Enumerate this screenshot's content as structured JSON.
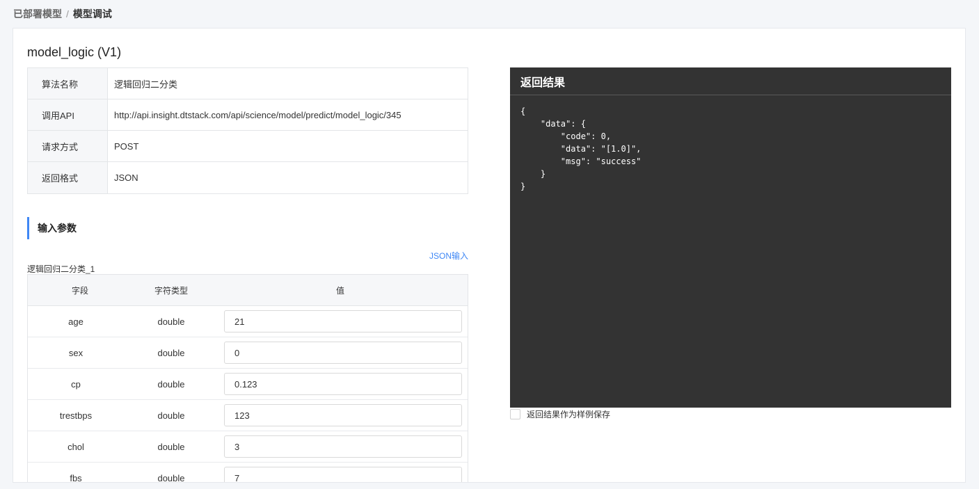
{
  "breadcrumb": {
    "parent": "已部署模型",
    "separator": "/",
    "current": "模型调试"
  },
  "model_title": "model_logic (V1)",
  "info": [
    {
      "key": "算法名称",
      "value": "逻辑回归二分类"
    },
    {
      "key": "调用API",
      "value": "http://api.insight.dtstack.com/api/science/model/predict/model_logic/345"
    },
    {
      "key": "请求方式",
      "value": "POST"
    },
    {
      "key": "返回格式",
      "value": "JSON"
    }
  ],
  "input_section": {
    "title": "输入参数",
    "json_link": "JSON输入",
    "group_label": "逻辑回归二分类_1",
    "headers": {
      "field": "字段",
      "type": "字符类型",
      "value": "值"
    },
    "rows": [
      {
        "field": "age",
        "type": "double",
        "value": "21"
      },
      {
        "field": "sex",
        "type": "double",
        "value": "0"
      },
      {
        "field": "cp",
        "type": "double",
        "value": "0.123"
      },
      {
        "field": "trestbps",
        "type": "double",
        "value": "123"
      },
      {
        "field": "chol",
        "type": "double",
        "value": "3"
      },
      {
        "field": "fbs",
        "type": "double",
        "value": "7"
      }
    ]
  },
  "result": {
    "title": "返回结果",
    "body": "{\n    \"data\": {\n        \"code\": 0,\n        \"data\": \"[1.0]\",\n        \"msg\": \"success\"\n    }\n}"
  },
  "save_checkbox": {
    "label": "返回结果作为样例保存",
    "checked": false
  },
  "colors": {
    "accent": "#3f87f5",
    "result_bg": "#333333",
    "page_bg": "#f4f6f9"
  }
}
